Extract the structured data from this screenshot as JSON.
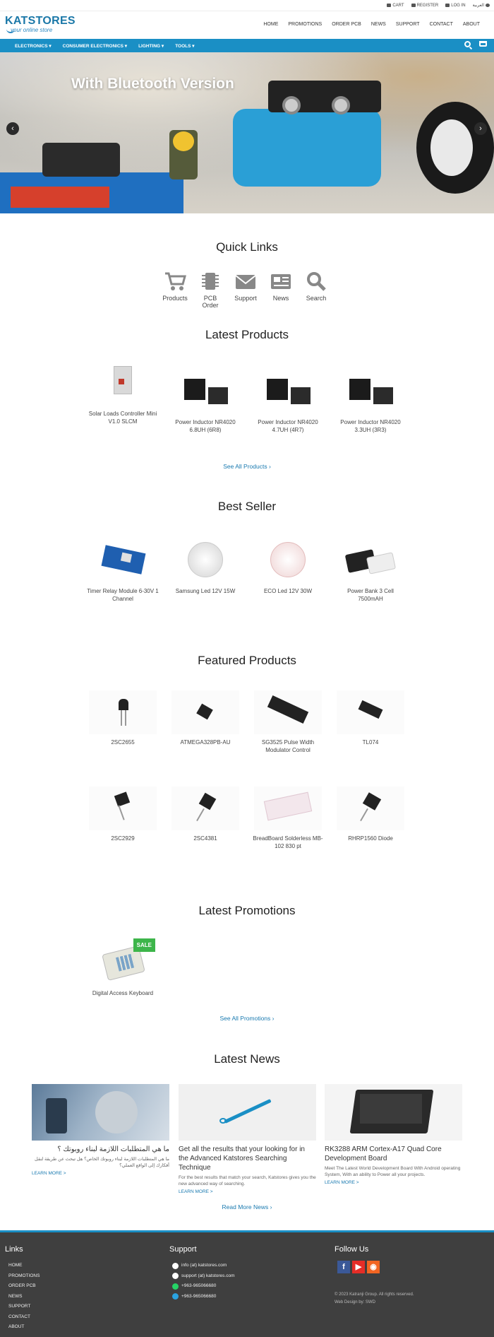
{
  "topbar": {
    "links": [
      "CART",
      "REGISTER",
      "LOG IN",
      "العربية"
    ]
  },
  "header": {
    "logo": "KATSTORES",
    "tagline": "your online store",
    "nav": [
      "HOME",
      "PROMOTIONS",
      "ORDER PCB",
      "NEWS",
      "SUPPORT",
      "CONTACT",
      "ABOUT"
    ]
  },
  "categories": [
    "ELECTRONICS",
    "CONSUMER ELECTRONICS",
    "LIGHTING",
    "TOOLS"
  ],
  "hero": {
    "title": "With Bluetooth Version",
    "prev": "‹",
    "next": "›"
  },
  "quick_links": {
    "title": "Quick Links",
    "items": [
      {
        "label": "Products",
        "icon": "cart-icon"
      },
      {
        "label": "PCB Order",
        "icon": "chip-icon"
      },
      {
        "label": "Support",
        "icon": "envelope-icon"
      },
      {
        "label": "News",
        "icon": "newspaper-icon"
      },
      {
        "label": "Search",
        "icon": "search-icon"
      }
    ]
  },
  "latest_products": {
    "title": "Latest Products",
    "items": [
      "Solar Loads Controller Mini V1.0 SLCM",
      "Power Inductor NR4020 6.8UH (6R8)",
      "Power Inductor NR4020 4.7UH (4R7)",
      "Power Inductor NR4020 3.3UH (3R3)"
    ],
    "see_all": "See All Products"
  },
  "best_seller": {
    "title": "Best Seller",
    "items": [
      "Timer Relay Module 6-30V 1 Channel",
      "Samsung Led 12V 15W",
      "ECO Led 12V 30W",
      "Power Bank 3 Cell 7500mAH"
    ]
  },
  "featured": {
    "title": "Featured Products",
    "row1": [
      "2SC2655",
      "ATMEGA328PB-AU",
      "SG3525 Pulse Width Modulator Control",
      "TL074"
    ],
    "row2": [
      "2SC2929",
      "2SC4381",
      "BreadBoard Solderless MB-102 830 pt",
      "RHRP1560 Diode"
    ]
  },
  "promotions": {
    "title": "Latest Promotions",
    "badge": "SALE",
    "item": "Digital Access Keyboard",
    "see_all": "See All Promotions"
  },
  "news": {
    "title": "Latest News",
    "items": [
      {
        "title": "ما هي المتطلبات اللازمة لبناء روبوتك ؟",
        "text": "ما هي المتطلبات اللازمة لبناء روبوتك الخاص؟ هل تبحث عن طريقة لنقل أفكارك إلى الواقع العملي؟",
        "more": "LEARN MORE >"
      },
      {
        "title": "Get all the results that your looking for in the Advanced Katstores Searching Technique",
        "text": "For the best results that match your search, Katstores gives you the new advanced way of searching.",
        "more": "LEARN MORE >"
      },
      {
        "title": "RK3288 ARM Cortex-A17 Quad Core Development Board",
        "text": "Meet The Latest World Development Board With Android operating System, With an ability to Power all your projects.",
        "more": "LEARN MORE >"
      }
    ],
    "read_more": "Read More News"
  },
  "footer": {
    "links_title": "Links",
    "links": [
      "HOME",
      "PROMOTIONS",
      "ORDER PCB",
      "NEWS",
      "SUPPORT",
      "CONTACT",
      "ABOUT"
    ],
    "support_title": "Support",
    "contacts": [
      "info (at) katstores.com",
      "support (at) katstores.com",
      "+963-965066680",
      "+963-965066680"
    ],
    "follow_title": "Follow Us",
    "copyright": "© 2023 Katranji Group. All rights reserved.",
    "design": "Web Design by: SWD"
  },
  "colors": {
    "accent": "#1a8fc5",
    "footer_bg": "#3f3f3f",
    "sale": "#3db54a"
  }
}
